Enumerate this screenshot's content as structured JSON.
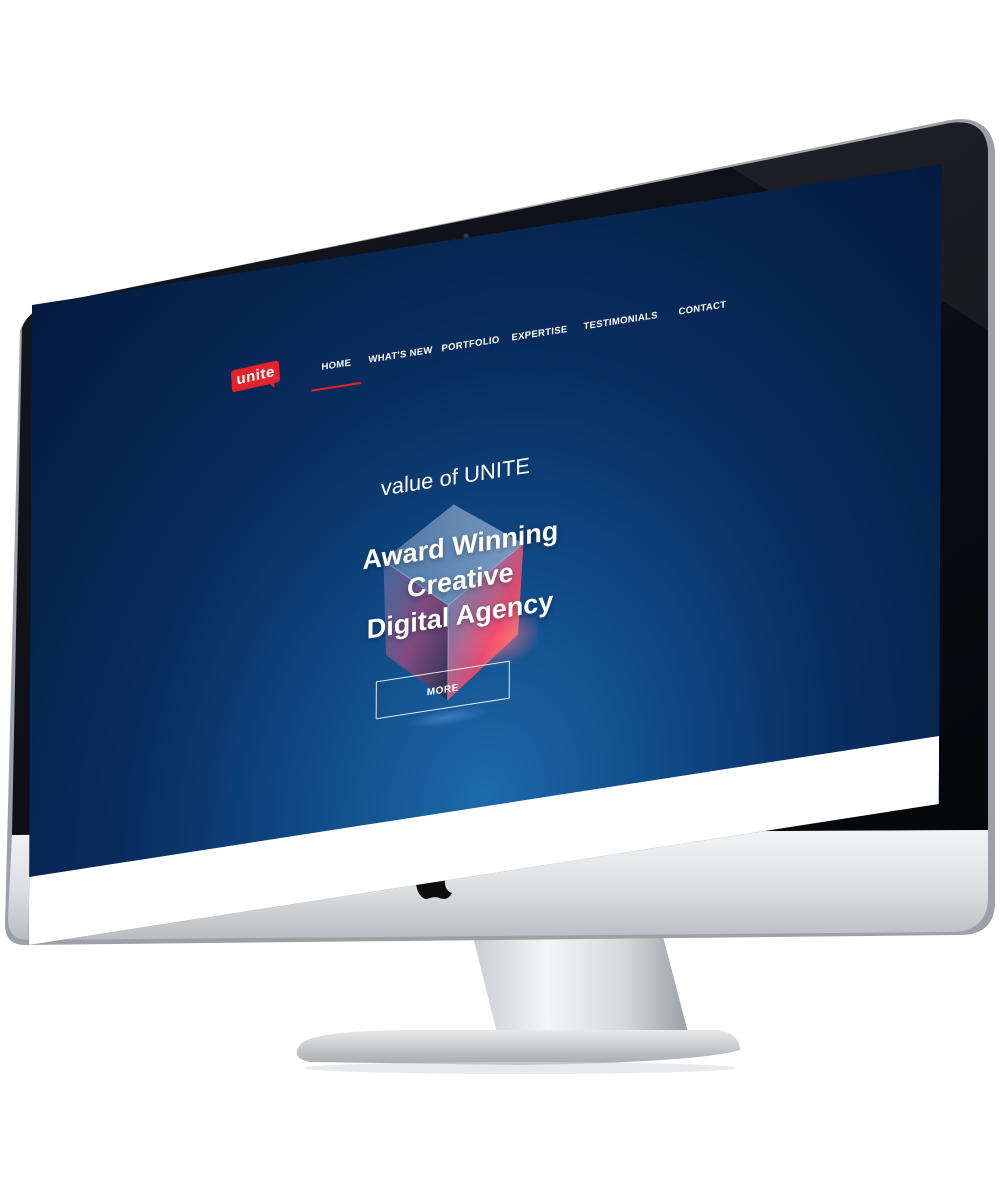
{
  "brand": {
    "logo_text": "unite",
    "logo_color": "#e4232a"
  },
  "nav": {
    "items": [
      {
        "label": "HOME",
        "active": true
      },
      {
        "label": "WHAT'S NEW",
        "active": false
      },
      {
        "label": "PORTFOLIO",
        "active": false
      },
      {
        "label": "EXPERTISE",
        "active": false
      },
      {
        "label": "TESTIMONIALS",
        "active": false
      },
      {
        "label": "CONTACT",
        "active": false
      }
    ],
    "active_indicator_color": "#e4232a"
  },
  "hero": {
    "subtitle": "value of UNITE",
    "title_line1": "Award Winning Creative",
    "title_line2": "Digital Agency",
    "more_button_label": "MORE",
    "background_colors": [
      "#041a3f",
      "#0f4a86",
      "#1e6aa8"
    ]
  },
  "device": {
    "type": "iMac",
    "logo_icon": "apple-logo-icon",
    "bezel_color": "#0b0d12",
    "chin_color": "#dfe1e4"
  }
}
